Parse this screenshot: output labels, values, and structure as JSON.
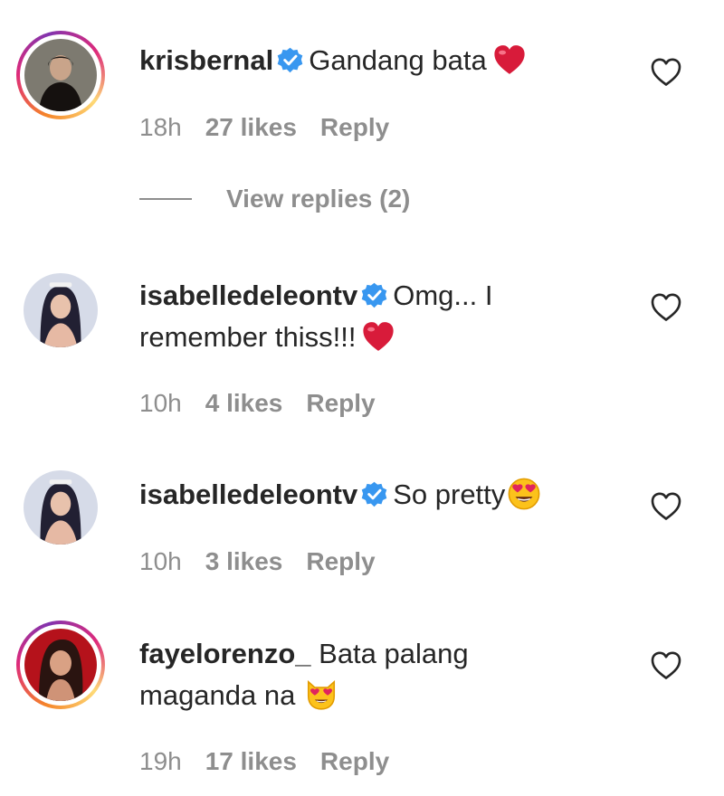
{
  "comments": [
    {
      "username": "krisbernal",
      "verified": true,
      "text": "Gandang bata",
      "emoji": "heart-emoji",
      "time": "18h",
      "likes": "27 likes",
      "reply": "Reply"
    },
    {
      "username": "isabelledeleontv",
      "verified": true,
      "text_line1": "Omg... I",
      "text_line2": "remember thiss!!!",
      "emoji": "heart-emoji",
      "time": "10h",
      "likes": "4 likes",
      "reply": "Reply"
    },
    {
      "username": "isabelledeleontv",
      "verified": true,
      "text": "So pretty",
      "emoji": "heart-eyes-emoji",
      "time": "10h",
      "likes": "3 likes",
      "reply": "Reply"
    },
    {
      "username": "fayelorenzo_",
      "verified": false,
      "text_line1": "Bata palang",
      "text_line2": "maganda na",
      "emoji": "heart-eyes-cat-emoji",
      "time": "19h",
      "likes": "17 likes",
      "reply": "Reply"
    }
  ],
  "view_replies": "View replies (2)",
  "colors": {
    "text": "#262626",
    "secondary": "#8e8e8e",
    "verified": "#3897f0",
    "heart": "#e0245e"
  }
}
